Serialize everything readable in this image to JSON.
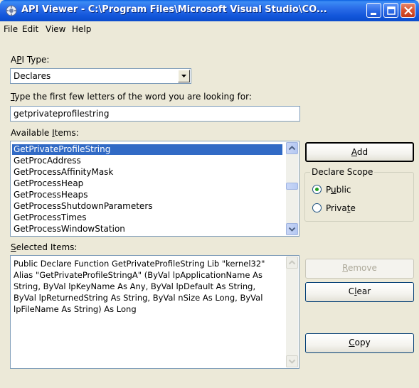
{
  "window": {
    "title": "API Viewer - C:\\Program Files\\Microsoft Visual Studio\\CO..."
  },
  "menu": {
    "file": "File",
    "edit": "Edit",
    "view": "View",
    "help": "Help"
  },
  "api_type": {
    "label_pre": "A",
    "label_u": "P",
    "label_post": "I Type:",
    "value": "Declares"
  },
  "search": {
    "label_u": "T",
    "label_post": "ype the first few letters of the word you are looking for:",
    "value": "getprivateprofilestring"
  },
  "available": {
    "label_pre": "Available ",
    "label_u": "I",
    "label_post": "tems:",
    "items": [
      "GetPrivateProfileString",
      "GetProcAddress",
      "GetProcessAffinityMask",
      "GetProcessHeap",
      "GetProcessHeaps",
      "GetProcessShutdownParameters",
      "GetProcessTimes",
      "GetProcessWindowStation"
    ],
    "selected_index": 0
  },
  "selected": {
    "label_u": "S",
    "label_post": "elected Items:",
    "text": "Public Declare Function GetPrivateProfileString Lib \"kernel32\"\nAlias \"GetPrivateProfileStringA\" (ByVal lpApplicationName As\nString, ByVal lpKeyName As Any, ByVal lpDefault As String,\nByVal lpReturnedString As String, ByVal nSize As Long, ByVal\nlpFileName As String) As Long"
  },
  "buttons": {
    "add_u": "A",
    "add_post": "dd",
    "remove_u": "R",
    "remove_post": "emove",
    "clear_pre": "C",
    "clear_u": "l",
    "clear_post": "ear",
    "copy_u": "C",
    "copy_post": "opy"
  },
  "scope": {
    "legend": "Declare Scope",
    "public_pre": "P",
    "public_u": "u",
    "public_post": "blic",
    "private_pre": "Priva",
    "private_u": "t",
    "private_post": "e",
    "selected": "public"
  },
  "colors": {
    "selection": "#316AC5",
    "radio_dot": "#21A121",
    "titlebar": "#1256DA"
  },
  "icons": {
    "app": "api-viewer-icon",
    "minimize": "minimize-icon",
    "maximize": "maximize-icon",
    "close": "close-icon",
    "dropdown": "chevron-down-icon"
  }
}
